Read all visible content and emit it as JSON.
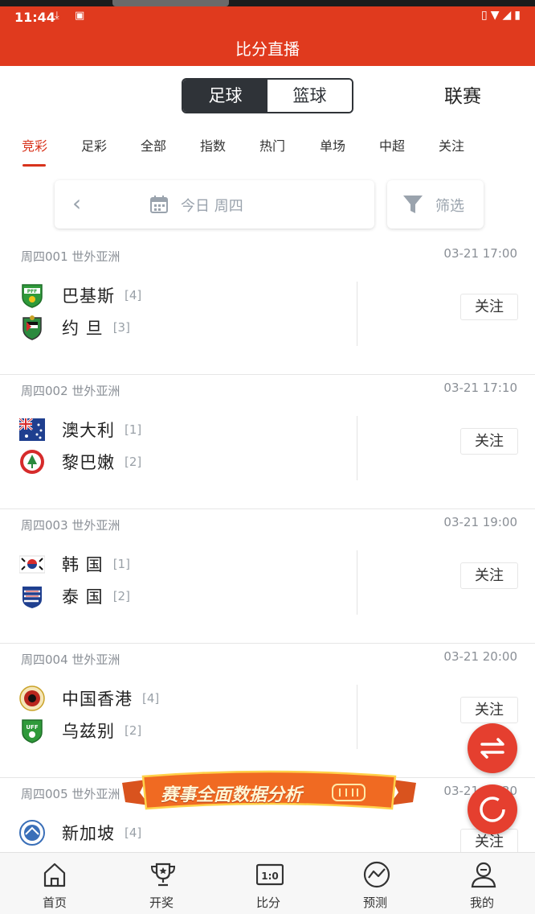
{
  "status_bar": {
    "time": "11:44"
  },
  "header": {
    "title": "比分直播"
  },
  "sport_switch": {
    "options": [
      "足球",
      "篮球"
    ],
    "selected": "足球"
  },
  "league_label": "联赛",
  "tabs": [
    {
      "label": "竞彩",
      "active": true
    },
    {
      "label": "足彩"
    },
    {
      "label": "全部"
    },
    {
      "label": "指数"
    },
    {
      "label": "热门"
    },
    {
      "label": "单场"
    },
    {
      "label": "中超"
    },
    {
      "label": "关注"
    }
  ],
  "date_bar": {
    "label": "今日 周四",
    "filter_label": "筛选"
  },
  "follow_label": "关注",
  "matches": [
    {
      "code": "周四001",
      "league": "世外亚洲",
      "time": "03-21 17:00",
      "home": {
        "name": "巴基斯",
        "rank": "[4]"
      },
      "away": {
        "name": "约 旦",
        "rank": "[3]"
      }
    },
    {
      "code": "周四002",
      "league": "世外亚洲",
      "time": "03-21 17:10",
      "home": {
        "name": "澳大利",
        "rank": "[1]"
      },
      "away": {
        "name": "黎巴嫩",
        "rank": "[2]"
      }
    },
    {
      "code": "周四003",
      "league": "世外亚洲",
      "time": "03-21 19:00",
      "home": {
        "name": "韩 国",
        "rank": "[1]"
      },
      "away": {
        "name": "泰 国",
        "rank": "[2]"
      }
    },
    {
      "code": "周四004",
      "league": "世外亚洲",
      "time": "03-21 20:00",
      "home": {
        "name": "中国香港",
        "rank": "[4]"
      },
      "away": {
        "name": "乌兹别",
        "rank": "[2]"
      }
    },
    {
      "code": "周四005",
      "league": "世外亚洲",
      "time": "03-21 20:30",
      "home": {
        "name": "新加坡",
        "rank": "[4]"
      }
    }
  ],
  "promo_banner": {
    "text": "赛事全面数据分析"
  },
  "bottom_nav": [
    {
      "label": "首页",
      "icon": "home-icon"
    },
    {
      "label": "开奖",
      "icon": "trophy-icon"
    },
    {
      "label": "比分",
      "icon": "scoreboard-icon"
    },
    {
      "label": "预测",
      "icon": "trend-icon"
    },
    {
      "label": "我的",
      "icon": "user-icon"
    }
  ],
  "colors": {
    "brand_red": "#e03a1e",
    "accent_red": "#d8331c",
    "dark": "#2f3338"
  }
}
